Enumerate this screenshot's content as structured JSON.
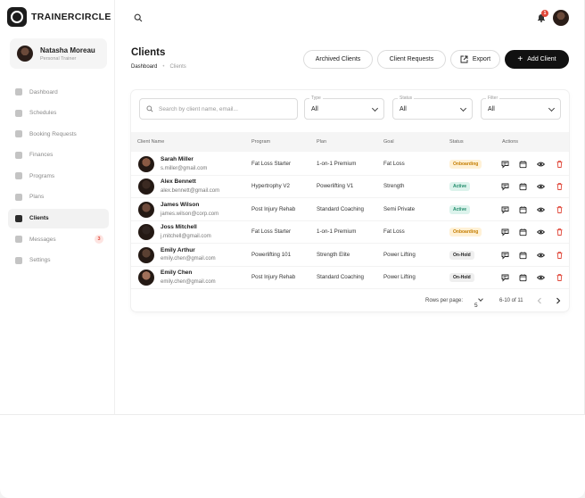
{
  "app": {
    "brand": "TRAINERCIRCLE"
  },
  "profile": {
    "name": "Natasha Moreau",
    "role": "Personal Trainer"
  },
  "sidebar": {
    "items": [
      {
        "label": "Dashboard",
        "icon": "dashboard-icon",
        "active": false
      },
      {
        "label": "Schedules",
        "icon": "calendar-icon",
        "active": false
      },
      {
        "label": "Booking Requests",
        "icon": "booking-icon",
        "active": false
      },
      {
        "label": "Finances",
        "icon": "dollar-icon",
        "active": false
      },
      {
        "label": "Programs",
        "icon": "dumbbell-icon",
        "active": false
      },
      {
        "label": "Plans",
        "icon": "plans-icon",
        "active": false
      },
      {
        "label": "Clients",
        "icon": "clients-icon",
        "active": true
      },
      {
        "label": "Messages",
        "icon": "message-icon",
        "active": false,
        "badge": "3"
      },
      {
        "label": "Settings",
        "icon": "gear-icon",
        "active": false
      }
    ]
  },
  "topbar": {
    "notifications": "1"
  },
  "header": {
    "title": "Clients",
    "breadcrumb": [
      "Dashboard",
      "Clients"
    ],
    "buttons": {
      "archived": "Archived Clients",
      "requests": "Client Requests",
      "export": "Export",
      "add": "Add Client"
    }
  },
  "filters": {
    "search_placeholder": "Search by client name, email...",
    "type": {
      "label": "Type",
      "value": "All"
    },
    "status": {
      "label": "Status",
      "value": "All"
    },
    "filter": {
      "label": "Filter",
      "value": "All"
    }
  },
  "table": {
    "columns": [
      "Client Name",
      "Program",
      "Plan",
      "Goal",
      "Status",
      "Actions"
    ],
    "rows": [
      {
        "name": "Sarah Miller",
        "email": "s.miller@gmail.com",
        "program": "Fat Loss Starter",
        "plan": "1-on-1 Premium",
        "goal": "Fat Loss",
        "status": "Onboarding"
      },
      {
        "name": "Alex Bennett",
        "email": "alex.bennett@gmail.com",
        "program": "Hypertrophy V2",
        "plan": "Powerlifting V1",
        "goal": "Strength",
        "status": "Active"
      },
      {
        "name": "James Wilson",
        "email": "james.wilson@corp.com",
        "program": "Post Injury Rehab",
        "plan": "Standard Coaching",
        "goal": "Semi Private",
        "status": "Active"
      },
      {
        "name": "Joss Mitchell",
        "email": "j.mitchell@gmail.com",
        "program": "Fat Loss Starter",
        "plan": "1-on-1 Premium",
        "goal": "Fat Loss",
        "status": "Onboarding"
      },
      {
        "name": "Emily Arthur",
        "email": "emily.chen@gmail.com",
        "program": "Powerlifting 101",
        "plan": "Strength Elite",
        "goal": "Power Lifting",
        "status": "On-Hold"
      },
      {
        "name": "Emily Chen",
        "email": "emily.chen@gmail.com",
        "program": "Post Injury Rehab",
        "plan": "Standard Coaching",
        "goal": "Power Lifting",
        "status": "On-Hold"
      }
    ]
  },
  "pagination": {
    "rows_label": "Rows per page:",
    "rows_value": "5",
    "range": "6-10 of 11"
  },
  "colors": {
    "primary": "#111111",
    "danger": "#e0483a",
    "onboarding": "#c47d00",
    "active": "#1f8a69"
  }
}
